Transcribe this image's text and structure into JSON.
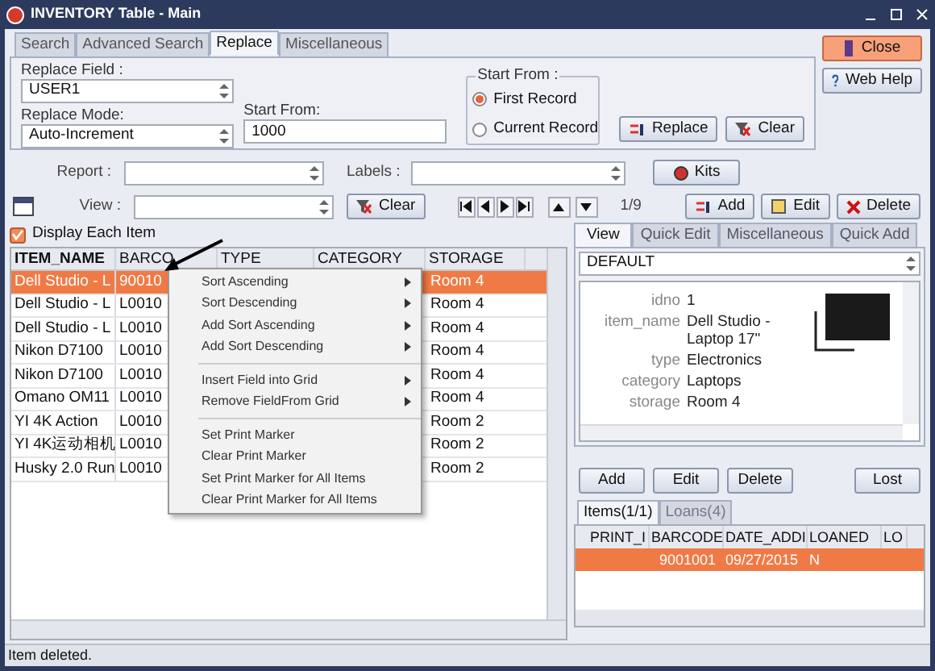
{
  "window": {
    "title": "INVENTORY Table - Main"
  },
  "search_tabs": [
    {
      "label": "Search",
      "selected": false
    },
    {
      "label": "Advanced Search",
      "selected": false
    },
    {
      "label": "Replace",
      "selected": true
    },
    {
      "label": "Miscellaneous",
      "selected": false
    }
  ],
  "replace": {
    "field_label": "Replace Field :",
    "field_value": "USER1",
    "mode_label": "Replace Mode:",
    "mode_value": "Auto-Increment",
    "start_label": "Start From:",
    "start_value": "1000",
    "group_title": "Start From :",
    "options": [
      {
        "label": "First Record",
        "selected": true
      },
      {
        "label": "Current Record",
        "selected": false
      }
    ],
    "replace_button": "Replace",
    "clear_button": "Clear"
  },
  "side_buttons": [
    {
      "label": "Close",
      "kind": "close"
    },
    {
      "label": "Web Help",
      "kind": "help"
    }
  ],
  "report_row": {
    "report_label": "Report :",
    "labels_label": "Labels :",
    "kits_button": "Kits"
  },
  "view_row": {
    "view_label": "View :",
    "clear_button": "Clear",
    "counter": "1/9",
    "add_button": "Add",
    "edit_button": "Edit",
    "delete_button": "Delete"
  },
  "display_each_item": {
    "label": "Display Each Item",
    "checked": true
  },
  "grid": {
    "columns": [
      "ITEM_NAME",
      "BARCO",
      "TYPE",
      "CATEGORY",
      "STORAGE"
    ],
    "rows": [
      {
        "cells": [
          "Dell Studio - L",
          "90010",
          "Room 4"
        ],
        "selected": true
      },
      {
        "cells": [
          "Dell Studio - L",
          "L0010",
          "Room 4"
        ],
        "selected": false
      },
      {
        "cells": [
          "Dell Studio - L",
          "L0010",
          "Room 4"
        ],
        "selected": false
      },
      {
        "cells": [
          "Nikon D7100",
          "L0010",
          "Room 4"
        ],
        "selected": false
      },
      {
        "cells": [
          "Nikon D7100",
          "L0010",
          "Room 4"
        ],
        "selected": false
      },
      {
        "cells": [
          "Omano OM11",
          "L0010",
          "Room 4"
        ],
        "selected": false
      },
      {
        "cells": [
          "YI 4K Action",
          "L0010",
          "Room 2"
        ],
        "selected": false
      },
      {
        "cells": [
          "YI 4K运动相机",
          "L0010",
          "Room 2"
        ],
        "selected": false
      },
      {
        "cells": [
          "Husky 2.0 Run",
          "L0010",
          "Room 2"
        ],
        "selected": false
      }
    ]
  },
  "context_menu": [
    {
      "label": "Sort Ascending",
      "submenu": true,
      "kind": "item"
    },
    {
      "label": "Sort Descending",
      "submenu": true,
      "kind": "item"
    },
    {
      "label": "Add Sort Ascending",
      "submenu": true,
      "kind": "item"
    },
    {
      "label": "Add Sort Descending",
      "submenu": true,
      "kind": "item"
    },
    {
      "kind": "separator"
    },
    {
      "label": "Insert Field into Grid",
      "submenu": true,
      "kind": "item"
    },
    {
      "label": "Remove FieldFrom Grid",
      "submenu": true,
      "kind": "item"
    },
    {
      "kind": "separator"
    },
    {
      "label": "Set Print Marker",
      "submenu": false,
      "kind": "item"
    },
    {
      "label": "Clear Print Marker",
      "submenu": false,
      "kind": "item"
    },
    {
      "label": "Set Print Marker for All Items",
      "submenu": false,
      "kind": "item"
    },
    {
      "label": "Clear Print Marker for All Items",
      "submenu": false,
      "kind": "item"
    }
  ],
  "detail_tabs": [
    {
      "label": "View",
      "selected": true
    },
    {
      "label": "Quick Edit",
      "selected": false
    },
    {
      "label": "Miscellaneous",
      "selected": false
    },
    {
      "label": "Quick Add",
      "selected": false
    }
  ],
  "detail_view": {
    "value": "DEFAULT",
    "fields": [
      {
        "label": "idno",
        "value": "1"
      },
      {
        "label": "item_name",
        "value": "Dell Studio - Laptop 17\""
      },
      {
        "label": "type",
        "value": "Electronics"
      },
      {
        "label": "category",
        "value": "Laptops"
      },
      {
        "label": "storage",
        "value": "Room 4"
      }
    ]
  },
  "detail_buttons": [
    "Add",
    "Edit",
    "Delete",
    "Lost"
  ],
  "sub_tabs": [
    {
      "label": "Items(1/1)",
      "selected": true
    },
    {
      "label": "Loans(4)",
      "selected": false
    }
  ],
  "sub_grid": {
    "columns": [
      "PRINT_I",
      "BARCODE",
      "DATE_ADDI",
      "LOANED",
      "LO"
    ],
    "rows": [
      {
        "cells": [
          "",
          "9001001",
          "09/27/2015",
          "N",
          ""
        ],
        "selected": true
      }
    ]
  },
  "status_bar": "Item deleted."
}
